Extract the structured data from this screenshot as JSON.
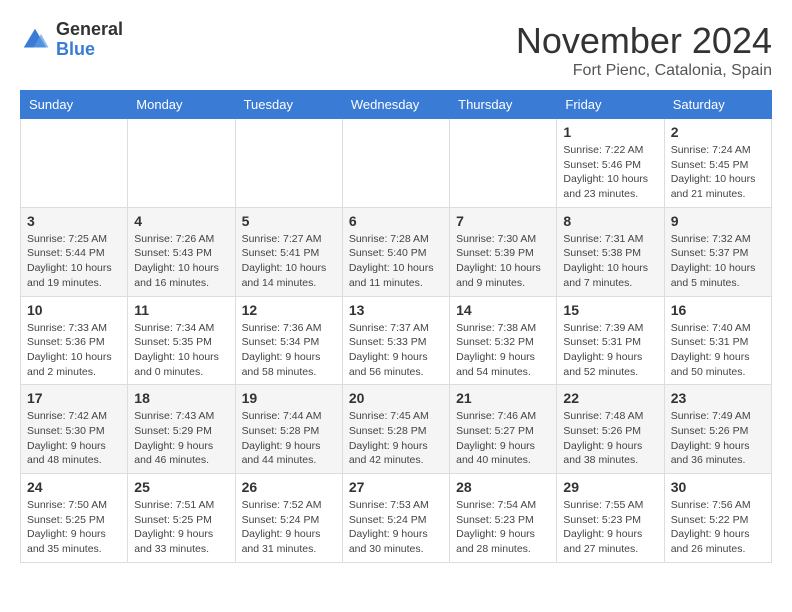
{
  "logo": {
    "general": "General",
    "blue": "Blue"
  },
  "title": "November 2024",
  "location": "Fort Pienc, Catalonia, Spain",
  "weekdays": [
    "Sunday",
    "Monday",
    "Tuesday",
    "Wednesday",
    "Thursday",
    "Friday",
    "Saturday"
  ],
  "weeks": [
    [
      {
        "day": "",
        "info": ""
      },
      {
        "day": "",
        "info": ""
      },
      {
        "day": "",
        "info": ""
      },
      {
        "day": "",
        "info": ""
      },
      {
        "day": "",
        "info": ""
      },
      {
        "day": "1",
        "info": "Sunrise: 7:22 AM\nSunset: 5:46 PM\nDaylight: 10 hours\nand 23 minutes."
      },
      {
        "day": "2",
        "info": "Sunrise: 7:24 AM\nSunset: 5:45 PM\nDaylight: 10 hours\nand 21 minutes."
      }
    ],
    [
      {
        "day": "3",
        "info": "Sunrise: 7:25 AM\nSunset: 5:44 PM\nDaylight: 10 hours\nand 19 minutes."
      },
      {
        "day": "4",
        "info": "Sunrise: 7:26 AM\nSunset: 5:43 PM\nDaylight: 10 hours\nand 16 minutes."
      },
      {
        "day": "5",
        "info": "Sunrise: 7:27 AM\nSunset: 5:41 PM\nDaylight: 10 hours\nand 14 minutes."
      },
      {
        "day": "6",
        "info": "Sunrise: 7:28 AM\nSunset: 5:40 PM\nDaylight: 10 hours\nand 11 minutes."
      },
      {
        "day": "7",
        "info": "Sunrise: 7:30 AM\nSunset: 5:39 PM\nDaylight: 10 hours\nand 9 minutes."
      },
      {
        "day": "8",
        "info": "Sunrise: 7:31 AM\nSunset: 5:38 PM\nDaylight: 10 hours\nand 7 minutes."
      },
      {
        "day": "9",
        "info": "Sunrise: 7:32 AM\nSunset: 5:37 PM\nDaylight: 10 hours\nand 5 minutes."
      }
    ],
    [
      {
        "day": "10",
        "info": "Sunrise: 7:33 AM\nSunset: 5:36 PM\nDaylight: 10 hours\nand 2 minutes."
      },
      {
        "day": "11",
        "info": "Sunrise: 7:34 AM\nSunset: 5:35 PM\nDaylight: 10 hours\nand 0 minutes."
      },
      {
        "day": "12",
        "info": "Sunrise: 7:36 AM\nSunset: 5:34 PM\nDaylight: 9 hours\nand 58 minutes."
      },
      {
        "day": "13",
        "info": "Sunrise: 7:37 AM\nSunset: 5:33 PM\nDaylight: 9 hours\nand 56 minutes."
      },
      {
        "day": "14",
        "info": "Sunrise: 7:38 AM\nSunset: 5:32 PM\nDaylight: 9 hours\nand 54 minutes."
      },
      {
        "day": "15",
        "info": "Sunrise: 7:39 AM\nSunset: 5:31 PM\nDaylight: 9 hours\nand 52 minutes."
      },
      {
        "day": "16",
        "info": "Sunrise: 7:40 AM\nSunset: 5:31 PM\nDaylight: 9 hours\nand 50 minutes."
      }
    ],
    [
      {
        "day": "17",
        "info": "Sunrise: 7:42 AM\nSunset: 5:30 PM\nDaylight: 9 hours\nand 48 minutes."
      },
      {
        "day": "18",
        "info": "Sunrise: 7:43 AM\nSunset: 5:29 PM\nDaylight: 9 hours\nand 46 minutes."
      },
      {
        "day": "19",
        "info": "Sunrise: 7:44 AM\nSunset: 5:28 PM\nDaylight: 9 hours\nand 44 minutes."
      },
      {
        "day": "20",
        "info": "Sunrise: 7:45 AM\nSunset: 5:28 PM\nDaylight: 9 hours\nand 42 minutes."
      },
      {
        "day": "21",
        "info": "Sunrise: 7:46 AM\nSunset: 5:27 PM\nDaylight: 9 hours\nand 40 minutes."
      },
      {
        "day": "22",
        "info": "Sunrise: 7:48 AM\nSunset: 5:26 PM\nDaylight: 9 hours\nand 38 minutes."
      },
      {
        "day": "23",
        "info": "Sunrise: 7:49 AM\nSunset: 5:26 PM\nDaylight: 9 hours\nand 36 minutes."
      }
    ],
    [
      {
        "day": "24",
        "info": "Sunrise: 7:50 AM\nSunset: 5:25 PM\nDaylight: 9 hours\nand 35 minutes."
      },
      {
        "day": "25",
        "info": "Sunrise: 7:51 AM\nSunset: 5:25 PM\nDaylight: 9 hours\nand 33 minutes."
      },
      {
        "day": "26",
        "info": "Sunrise: 7:52 AM\nSunset: 5:24 PM\nDaylight: 9 hours\nand 31 minutes."
      },
      {
        "day": "27",
        "info": "Sunrise: 7:53 AM\nSunset: 5:24 PM\nDaylight: 9 hours\nand 30 minutes."
      },
      {
        "day": "28",
        "info": "Sunrise: 7:54 AM\nSunset: 5:23 PM\nDaylight: 9 hours\nand 28 minutes."
      },
      {
        "day": "29",
        "info": "Sunrise: 7:55 AM\nSunset: 5:23 PM\nDaylight: 9 hours\nand 27 minutes."
      },
      {
        "day": "30",
        "info": "Sunrise: 7:56 AM\nSunset: 5:22 PM\nDaylight: 9 hours\nand 26 minutes."
      }
    ]
  ],
  "colors": {
    "header_bg": "#3a7bd5",
    "accent": "#3a7bd5"
  }
}
